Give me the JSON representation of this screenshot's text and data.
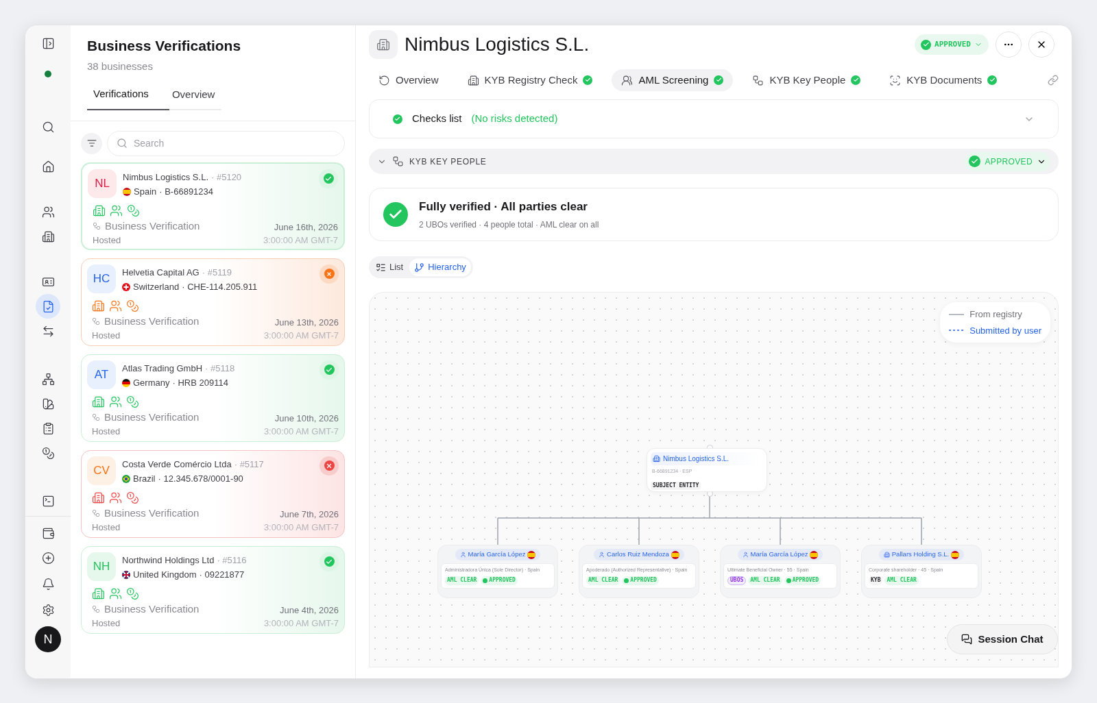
{
  "nav": [
    {
      "selected": false
    },
    {
      "selected": false
    },
    {
      "selected": false
    },
    {
      "selected": false
    },
    {
      "selected": false
    },
    {
      "selected": false
    },
    {
      "selected": true
    },
    {
      "selected": false
    },
    {
      "selected": false
    },
    {
      "selected": false
    },
    {
      "selected": false
    },
    {
      "selected": false
    },
    {
      "selected": false
    },
    {
      "selected": false
    },
    {
      "selected": false
    },
    {
      "selected": false
    },
    {
      "selected": false
    }
  ],
  "user": {
    "initial": "N"
  },
  "list": {
    "title": "Business Verifications",
    "subtitle": "38 businesses",
    "tabs": [
      {
        "label": "Verifications",
        "selected": true
      },
      {
        "label": "Overview",
        "selected": false
      }
    ],
    "search": {
      "placeholder": "Search"
    },
    "cards": [
      {
        "initials": "NL",
        "name": "Nimbus Logistics S.L.",
        "number": "· #5120",
        "country": "Spain",
        "reg_id": "· B-66891234",
        "kind": "approved",
        "selected": true,
        "type": "Business Verification",
        "mode": "Hosted",
        "date": "June 16th, 2026",
        "time": "3:00:00 AM GMT-7"
      },
      {
        "initials": "HC",
        "name": "Helvetia Capital AG",
        "number": "· #5119",
        "country": "Switzerland",
        "reg_id": "· CHE-114.205.911",
        "kind": "warning",
        "selected": false,
        "type": "Business Verification",
        "mode": "Hosted",
        "date": "June 13th, 2026",
        "time": "3:00:00 AM GMT-7"
      },
      {
        "initials": "AT",
        "name": "Atlas Trading GmbH",
        "number": "· #5118",
        "country": "Germany",
        "reg_id": "· HRB 209114",
        "kind": "approved",
        "selected": false,
        "type": "Business Verification",
        "mode": "Hosted",
        "date": "June 10th, 2026",
        "time": "3:00:00 AM GMT-7"
      },
      {
        "initials": "CV",
        "name": "Costa Verde Comércio Ltda",
        "number": "· #5117",
        "country": "Brazil",
        "reg_id": "· 12.345.678/0001-90",
        "kind": "rejected",
        "selected": false,
        "type": "Business Verification",
        "mode": "Hosted",
        "date": "June 7th, 2026",
        "time": "3:00:00 AM GMT-7"
      },
      {
        "initials": "NH",
        "name": "Northwind Holdings Ltd",
        "number": "· #5116",
        "country": "United Kingdom",
        "reg_id": "· 09221877",
        "kind": "approved",
        "selected": false,
        "type": "Business Verification",
        "mode": "Hosted",
        "date": "June 4th, 2026",
        "time": "3:00:00 AM GMT-7"
      }
    ]
  },
  "detail": {
    "title": "Nimbus Logistics S.L.",
    "status": "APPROVED",
    "tabs": [
      {
        "label": "Overview",
        "checked": false,
        "selected": false
      },
      {
        "label": "KYB Registry Check",
        "checked": true,
        "selected": false
      },
      {
        "label": "AML Screening",
        "checked": true,
        "selected": true
      },
      {
        "label": "KYB Key People",
        "checked": true,
        "selected": false
      },
      {
        "label": "KYB Documents",
        "checked": true,
        "selected": false
      }
    ],
    "checks": {
      "label": "Checks list",
      "note": "(No risks detected)"
    },
    "section": {
      "title": "KYB KEY PEOPLE",
      "status": "APPROVED"
    },
    "summary": {
      "title": "Fully verified · All parties clear",
      "subtitle": "2 UBOs verified · 4 people total · AML clear on all"
    },
    "views": [
      {
        "label": "List",
        "selected": false
      },
      {
        "label": "Hierarchy",
        "selected": true
      }
    ],
    "legend": [
      {
        "kind": "solid",
        "label": "From registry"
      },
      {
        "kind": "dashed",
        "label": "Submitted by user"
      }
    ],
    "tree": {
      "root": {
        "name": "Nimbus Logistics S.L.",
        "meta": "B-66891234 · ESP",
        "tag": "SUBJECT ENTITY"
      },
      "children": [
        {
          "kind": "person",
          "name": "María García López",
          "role": "Administradora Única (Sole Director) · Spain",
          "badges": [
            {
              "kind": "aml",
              "label": "AML CLEAR"
            },
            {
              "kind": "approved",
              "label": "APPROVED"
            }
          ]
        },
        {
          "kind": "person",
          "name": "Carlos Ruiz Mendoza",
          "role": "Apoderado (Authorized Representative) · Spain",
          "badges": [
            {
              "kind": "aml",
              "label": "AML CLEAR"
            },
            {
              "kind": "approved",
              "label": "APPROVED"
            }
          ]
        },
        {
          "kind": "person",
          "name": "María García López",
          "role": "Ultimate Beneficial Owner · 55 · Spain",
          "badges": [
            {
              "kind": "ubos",
              "label": "UBOS"
            },
            {
              "kind": "aml",
              "label": "AML CLEAR"
            },
            {
              "kind": "approved",
              "label": "APPROVED"
            }
          ]
        },
        {
          "kind": "company",
          "name": "Pallars Holding S.L.",
          "role": "Corporate shareholder · 45 · Spain",
          "badges": [
            {
              "kind": "kyb",
              "label": "KYB"
            },
            {
              "kind": "aml",
              "label": "AML CLEAR"
            }
          ]
        }
      ]
    },
    "chat": {
      "label": "Session Chat"
    }
  }
}
